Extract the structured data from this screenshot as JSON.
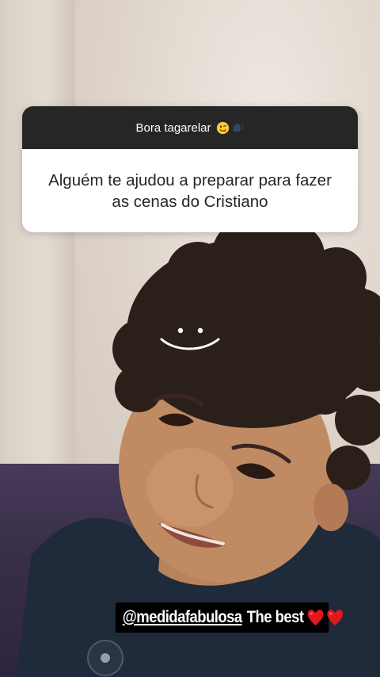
{
  "question_sticker": {
    "title": "Bora tagarelar",
    "title_icons": [
      "drooling-face-emoji",
      "speaking-head-emoji"
    ],
    "question_line1": "Alguém te ajudou a preparar para fazer",
    "question_line2": "as cenas do Cristiano"
  },
  "caption": {
    "handle": "@medidafabulosa",
    "text": "The best",
    "icons": [
      "red-heart-emoji",
      "red-heart-emoji"
    ]
  },
  "colors": {
    "sticker_header": "#262626",
    "sticker_body": "#ffffff",
    "caption_bg": "#000000",
    "heart": "#e0191f"
  }
}
